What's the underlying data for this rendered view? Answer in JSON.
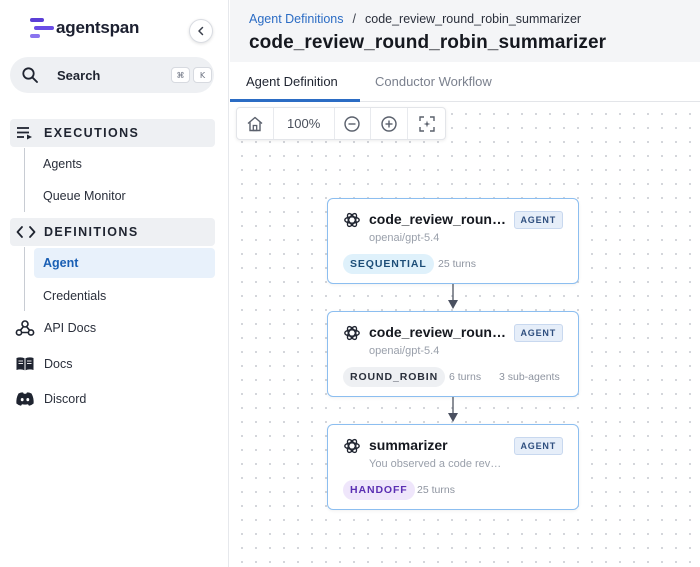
{
  "app": {
    "name": "agentspan"
  },
  "sidebar": {
    "collapse_icon": "chevron-left-icon",
    "search": {
      "label": "Search",
      "shortcut_keys": [
        "⌘",
        "K"
      ]
    },
    "sections": [
      {
        "label": "EXECUTIONS",
        "icon": "executions-icon",
        "items": [
          {
            "label": "Agents"
          },
          {
            "label": "Queue Monitor"
          }
        ]
      },
      {
        "label": "DEFINITIONS",
        "icon": "code-icon",
        "items": [
          {
            "label": "Agent",
            "active": true
          },
          {
            "label": "Credentials"
          }
        ]
      }
    ],
    "links": [
      {
        "label": "API Docs",
        "icon": "webhook-icon"
      },
      {
        "label": "Docs",
        "icon": "book-icon"
      },
      {
        "label": "Discord",
        "icon": "discord-icon"
      }
    ]
  },
  "header": {
    "breadcrumb": {
      "parent": "Agent Definitions",
      "separator": "/",
      "current": "code_review_round_robin_summarizer"
    },
    "title": "code_review_round_robin_summarizer"
  },
  "tabs": [
    {
      "label": "Agent Definition",
      "active": true
    },
    {
      "label": "Conductor Workflow",
      "active": false
    }
  ],
  "toolbar": {
    "zoom": "100%",
    "icons": [
      "home-icon",
      "zoom-out-icon",
      "zoom-in-icon",
      "fit-view-icon"
    ]
  },
  "nodes": [
    {
      "title": "code_review_roun…",
      "badge": "AGENT",
      "subtitle": "openai/gpt-5.4",
      "strategy": "SEQUENTIAL",
      "turns": "25 turns",
      "extra": ""
    },
    {
      "title": "code_review_round…",
      "badge": "AGENT",
      "subtitle": "openai/gpt-5.4",
      "strategy": "ROUND_ROBIN",
      "turns": "6 turns",
      "extra": "3 sub-agents"
    },
    {
      "title": "summarizer",
      "badge": "AGENT",
      "subtitle": "You observed a code rev…",
      "strategy": "HANDOFF",
      "turns": "25 turns",
      "extra": ""
    }
  ],
  "colors": {
    "accent": "#2b6cc4",
    "node_border": "#8cbef0",
    "brand": "#5b3fd6"
  }
}
